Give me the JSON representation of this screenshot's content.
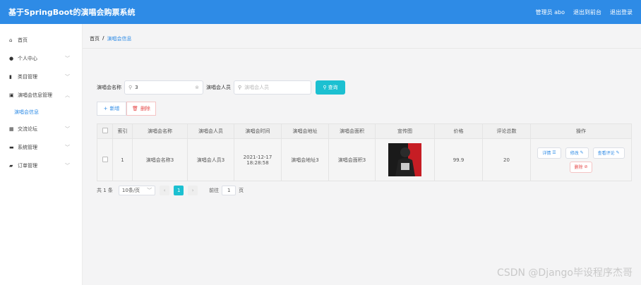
{
  "header": {
    "title": "基于SpringBoot的演唱会购票系统",
    "user": "管理员 abo",
    "exit_back": "退出到前台",
    "logout": "退出登录"
  },
  "sidebar": {
    "items": [
      {
        "label": "首页",
        "icon": "home-icon",
        "glyph": "⌂"
      },
      {
        "label": "个人中心",
        "icon": "user-icon",
        "glyph": "●"
      },
      {
        "label": "类目管理",
        "icon": "chart-icon",
        "glyph": "▮"
      },
      {
        "label": "演唱会信息管理",
        "icon": "ticket-icon",
        "glyph": "▣"
      },
      {
        "label": "演唱会信息",
        "icon": "",
        "glyph": ""
      },
      {
        "label": "交流论坛",
        "icon": "grid-icon",
        "glyph": "▦"
      },
      {
        "label": "系统管理",
        "icon": "settings-icon",
        "glyph": "▬"
      },
      {
        "label": "订单管理",
        "icon": "order-icon",
        "glyph": "▰"
      }
    ]
  },
  "breadcrumb": {
    "home": "首页",
    "sep": "/",
    "current": "演唱会信息"
  },
  "search": {
    "name_label": "演唱会名称",
    "name_value": "3",
    "performer_label": "演唱会人员",
    "performer_placeholder": "演唱会人员",
    "query_button": "查询"
  },
  "toolbar": {
    "add_label": "新增",
    "delete_label": "删除"
  },
  "table": {
    "headers": [
      "",
      "索引",
      "演唱会名称",
      "演唱会人员",
      "演唱会时间",
      "演唱会地址",
      "演唱会面积",
      "宣传图",
      "价格",
      "评论总数",
      "操作"
    ],
    "rows": [
      {
        "index": "1",
        "name": "演唱会名称3",
        "performer": "演唱会人员3",
        "time": "2021-12-17 18:28:58",
        "address": "演唱会地址3",
        "area": "演唱会面积3",
        "price": "99.9",
        "comments": "20"
      }
    ],
    "ops": {
      "detail": "详情",
      "edit": "修改",
      "view_comments": "查看评论",
      "delete": "删除"
    }
  },
  "pagination": {
    "total": "共 1 条",
    "page_size": "10条/页",
    "current": "1",
    "goto_label": "前往",
    "goto_value": "1",
    "page_unit": "页"
  },
  "watermark": "CSDN @Django毕设程序杰哥"
}
